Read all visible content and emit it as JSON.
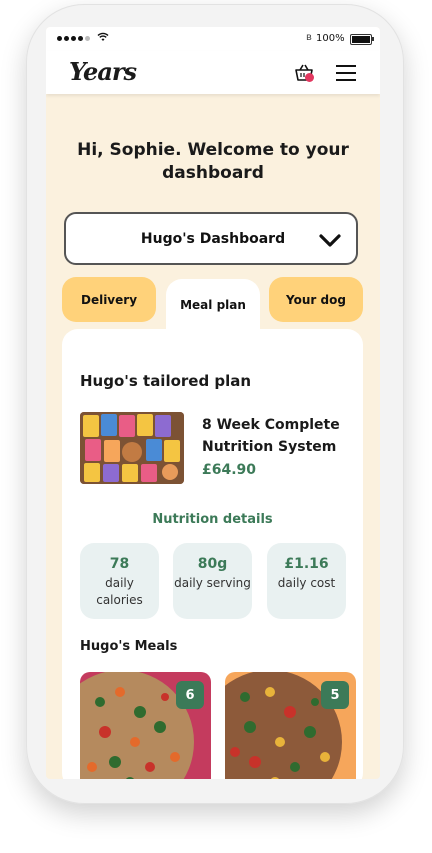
{
  "status_bar": {
    "battery": "100%"
  },
  "header": {
    "logo": "Years",
    "cart_count": ""
  },
  "greeting": "Hi, Sophie. Welcome to your dashboard",
  "dashboard_select": {
    "value": "Hugo's Dashboard"
  },
  "tabs": [
    {
      "label": "Delivery",
      "active": false
    },
    {
      "label": "Meal plan",
      "active": true
    },
    {
      "label": "Your dog",
      "active": false
    }
  ],
  "plan": {
    "title": "Hugo's tailored plan",
    "name": "8 Week Complete Nutrition System",
    "price": "£64.90"
  },
  "nutrition": {
    "title": "Nutrition details",
    "stats": [
      {
        "value": "78",
        "label": "daily calories"
      },
      {
        "value": "80g",
        "label": "daily serving"
      },
      {
        "value": "£1.16",
        "label": "daily cost"
      }
    ]
  },
  "meals": {
    "title": "Hugo's Meals",
    "items": [
      {
        "count": "6",
        "color": "#c43b5e"
      },
      {
        "count": "5",
        "color": "#f6a65b"
      }
    ]
  },
  "colors": {
    "accent": "#3c7a58",
    "tab": "#ffd27a",
    "background": "#fbf1de"
  }
}
